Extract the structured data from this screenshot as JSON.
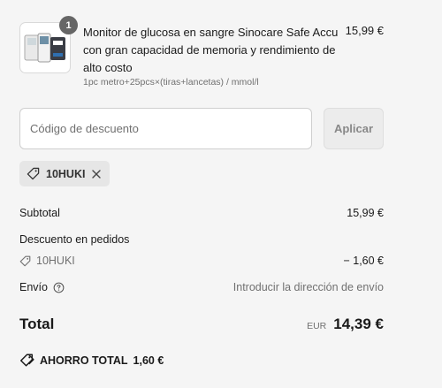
{
  "product": {
    "quantity": "1",
    "title": "Monitor de glucosa en sangre Sinocare Safe Accu con gran capacidad de memoria y rendimiento de alto costo",
    "variant": "1pc metro+25pcs×(tiras+lancetas) / mmol/l",
    "price": "15,99 €",
    "image_icon": "glucose-meter-kit-image"
  },
  "discount": {
    "placeholder": "Código de descuento",
    "value": "",
    "apply_label": "Aplicar",
    "applied_code": "10HUKI"
  },
  "summary": {
    "subtotal_label": "Subtotal",
    "subtotal_value": "15,99 €",
    "order_discount_label": "Descuento en pedidos",
    "discount_code": "10HUKI",
    "discount_value": "− 1,60 €",
    "shipping_label": "Envío",
    "shipping_value": "Introducir la dirección de envío",
    "total_label": "Total",
    "total_currency": "EUR",
    "total_value": "14,39 €",
    "savings_label": "AHORRO TOTAL",
    "savings_value": "1,60 €"
  },
  "colors": {
    "background": "#f5f5f5",
    "text": "#1a1a1a",
    "muted": "#707070",
    "badge": "#666666"
  }
}
